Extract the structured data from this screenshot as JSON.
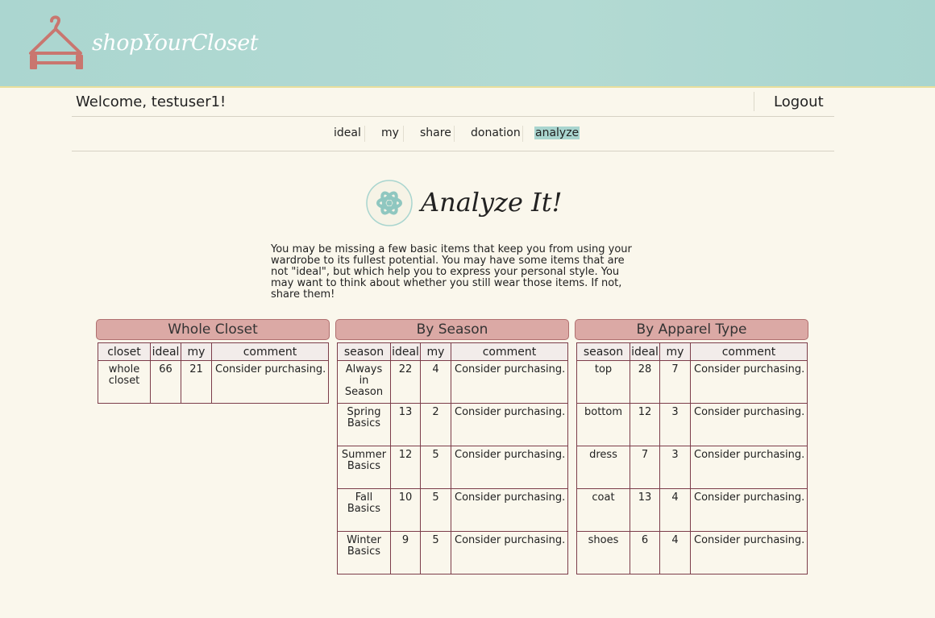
{
  "brand": {
    "name": "shopYourCloset"
  },
  "user_bar": {
    "welcome": "Welcome, testuser1!",
    "logout": "Logout"
  },
  "nav": {
    "items": [
      "ideal",
      "my",
      "share",
      "donation",
      "analyze"
    ],
    "active": "analyze"
  },
  "page": {
    "title": "Analyze It!",
    "intro": "You may be missing a few basic items that keep you from using your wardrobe to its fullest potential. You may have some items that are not \"ideal\", but which help you to express your personal style. You may want to think about whether you still wear those items. If not, share them!"
  },
  "tables": {
    "whole": {
      "title": "Whole Closet",
      "headers": [
        "closet",
        "ideal",
        "my",
        "comment"
      ],
      "rows": [
        [
          "whole closet",
          "66",
          "21",
          "Consider purchasing."
        ]
      ]
    },
    "season": {
      "title": "By Season",
      "headers": [
        "season",
        "ideal",
        "my",
        "comment"
      ],
      "rows": [
        [
          "Always in Season",
          "22",
          "4",
          "Consider purchasing."
        ],
        [
          "Spring Basics",
          "13",
          "2",
          "Consider purchasing."
        ],
        [
          "Summer Basics",
          "12",
          "5",
          "Consider purchasing."
        ],
        [
          "Fall Basics",
          "10",
          "5",
          "Consider purchasing."
        ],
        [
          "Winter Basics",
          "9",
          "5",
          "Consider purchasing."
        ]
      ]
    },
    "apparel": {
      "title": "By Apparel Type",
      "headers": [
        "season",
        "ideal",
        "my",
        "comment"
      ],
      "rows": [
        [
          "top",
          "28",
          "7",
          "Consider purchasing."
        ],
        [
          "bottom",
          "12",
          "3",
          "Consider purchasing."
        ],
        [
          "dress",
          "7",
          "3",
          "Consider purchasing."
        ],
        [
          "coat",
          "13",
          "4",
          "Consider purchasing."
        ],
        [
          "shoes",
          "6",
          "4",
          "Consider purchasing."
        ]
      ]
    }
  },
  "icons": {
    "logo": "hanger-icon",
    "analyze": "atom-icon"
  },
  "colors": {
    "header": "#abd6d0",
    "accent": "#d9a7a3",
    "background": "#faf7ec",
    "table_border": "#7c3d4a"
  }
}
